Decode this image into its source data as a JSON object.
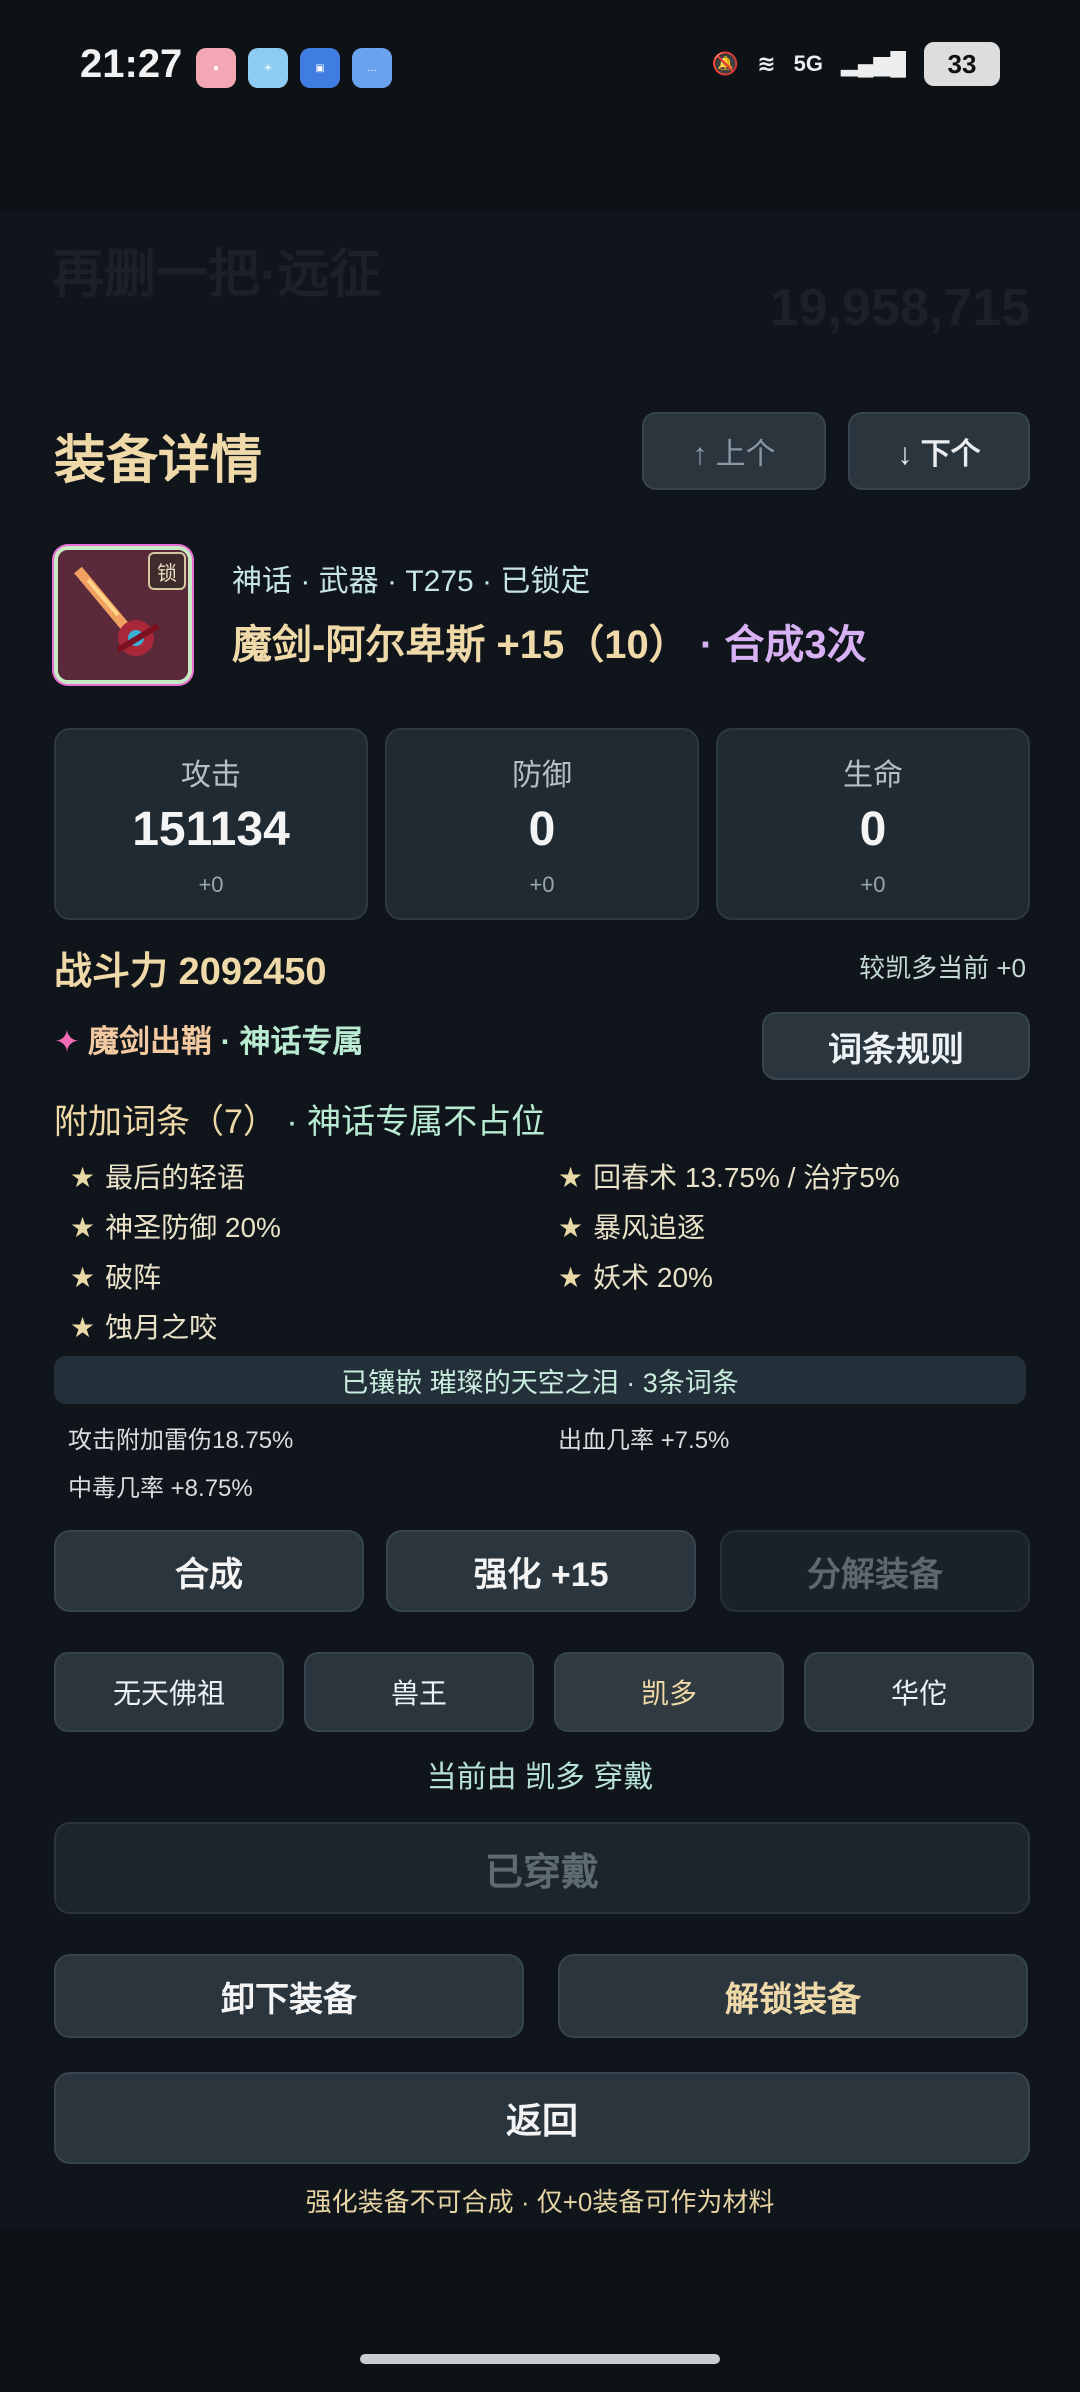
{
  "status_bar": {
    "time": "21:27",
    "network": "5G",
    "battery": "33"
  },
  "background": {
    "title": "再删一把·远征",
    "number": "19,958,715"
  },
  "panel": {
    "title": "装备详情",
    "prev_label": "↑ 上个",
    "next_label": "↓ 下个"
  },
  "equipment": {
    "lock_badge": "锁",
    "meta": "神话 · 武器 · T275 · 已锁定",
    "name_main": "魔剑-阿尔卑斯 +15（10）",
    "name_suffix": " · 合成3次"
  },
  "stats": [
    {
      "label": "攻击",
      "value": "151134",
      "delta": "+0"
    },
    {
      "label": "防御",
      "value": "0",
      "delta": "+0"
    },
    {
      "label": "生命",
      "value": "0",
      "delta": "+0"
    }
  ],
  "power": {
    "label": "战斗力 2092450",
    "compare": "较凯多当前 +0"
  },
  "exclusive": {
    "star": "✦",
    "name": "魔剑出鞘",
    "tag": " · 神话专属"
  },
  "rules_button": "词条规则",
  "affix_section": {
    "title": "附加词条（7）",
    "note": " · 神话专属不占位",
    "items": [
      "最后的轻语",
      "回春术 13.75% / 治疗5%",
      "神圣防御 20%",
      "暴风追逐",
      "破阵",
      "妖术 20%",
      "蚀月之咬"
    ]
  },
  "socket": {
    "title": "已镶嵌 璀璨的天空之泪 · 3条词条",
    "items": [
      "攻击附加雷伤18.75%",
      "出血几率 +7.5%",
      "中毒几率 +8.75%"
    ]
  },
  "actions": {
    "synthesize": "合成",
    "enhance": "强化 +15",
    "decompose": "分解装备"
  },
  "heroes": [
    "无天佛祖",
    "兽王",
    "凯多",
    "华佗"
  ],
  "wearer_text": "当前由 凯多 穿戴",
  "equipped_button": "已穿戴",
  "unequip_button": "卸下装备",
  "unlock_button": "解锁装备",
  "back_button": "返回",
  "footnote": "强化装备不可合成 · 仅+0装备可作为材料"
}
